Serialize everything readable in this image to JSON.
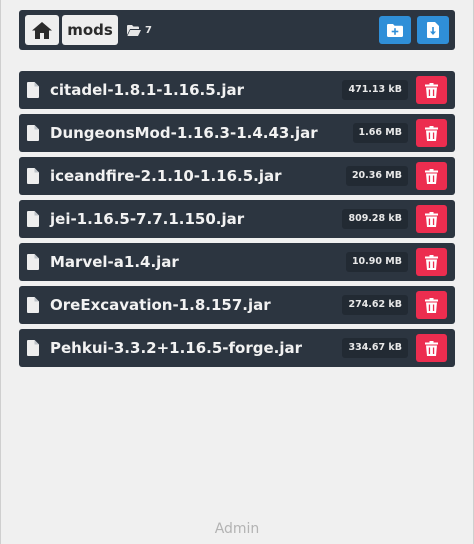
{
  "toolbar": {
    "home_icon": "home-icon",
    "breadcrumb": "mods",
    "folder_icon": "folder-open-icon",
    "folder_count": "7",
    "new_folder_icon": "folder-plus-icon",
    "upload_icon": "file-download-icon"
  },
  "files": [
    {
      "name": "citadel-1.8.1-1.16.5.jar",
      "size": "471.13 kB"
    },
    {
      "name": "DungeonsMod-1.16.3-1.4.43.jar",
      "size": "1.66 MB"
    },
    {
      "name": "iceandfire-2.1.10-1.16.5.jar",
      "size": "20.36 MB"
    },
    {
      "name": "jei-1.16.5-7.7.1.150.jar",
      "size": "809.28 kB"
    },
    {
      "name": "Marvel-a1.4.jar",
      "size": "10.90 MB"
    },
    {
      "name": "OreExcavation-1.8.157.jar",
      "size": "274.62 kB"
    },
    {
      "name": "Pehkui-3.3.2+1.16.5-forge.jar",
      "size": "334.67 kB"
    }
  ],
  "footer": {
    "label": "Admin"
  },
  "colors": {
    "background": "#f0f0f0",
    "panel": "#2c3540",
    "accent_blue": "#2f8fd8",
    "danger_red": "#ec2d4f"
  }
}
